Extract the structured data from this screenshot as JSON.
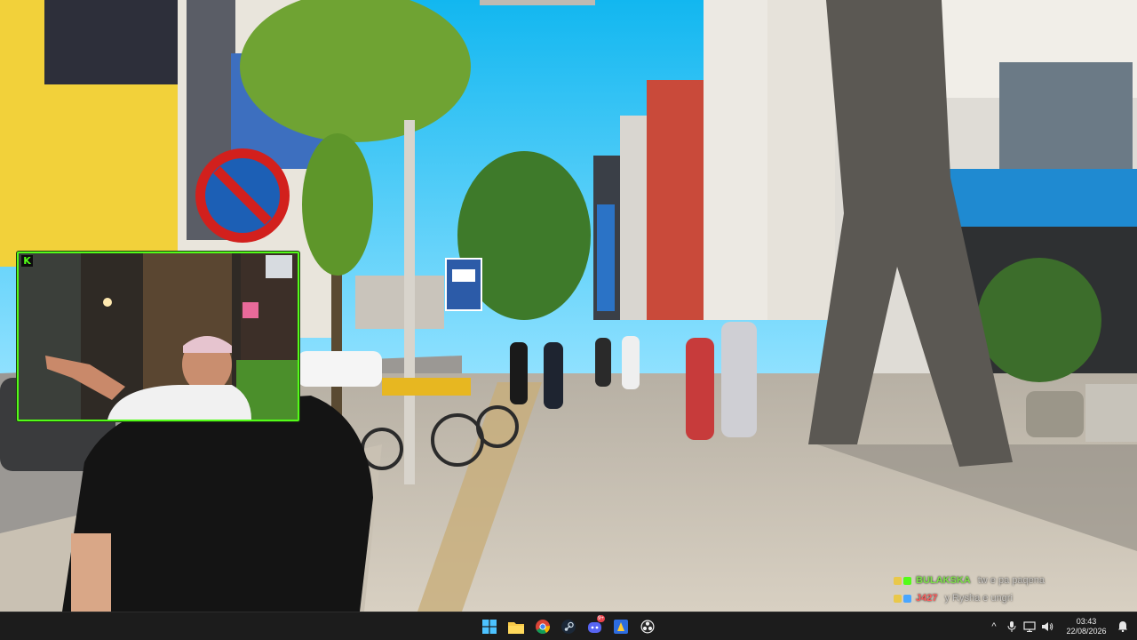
{
  "stream": {
    "platform_logo": "K",
    "chat": [
      {
        "user": "BULAKSKA",
        "message": "tw e pa paqena",
        "user_color": "#7ee24a"
      },
      {
        "user": "J427",
        "message": "y Rysha e ungri",
        "user_color": "#ff5e5e"
      }
    ]
  },
  "taskbar": {
    "apps": [
      {
        "icon": "windows-start-icon"
      },
      {
        "icon": "file-explorer-icon"
      },
      {
        "icon": "chrome-icon"
      },
      {
        "icon": "steam-icon"
      },
      {
        "icon": "discord-icon",
        "badge": "9+"
      },
      {
        "icon": "app-icon"
      },
      {
        "icon": "obs-icon"
      }
    ],
    "tray": {
      "chevron": "^",
      "time": "03:43",
      "date": "22/08/2026"
    }
  },
  "colors": {
    "facecam_border": "#53fc18",
    "taskbar": "#1c1c1c"
  }
}
